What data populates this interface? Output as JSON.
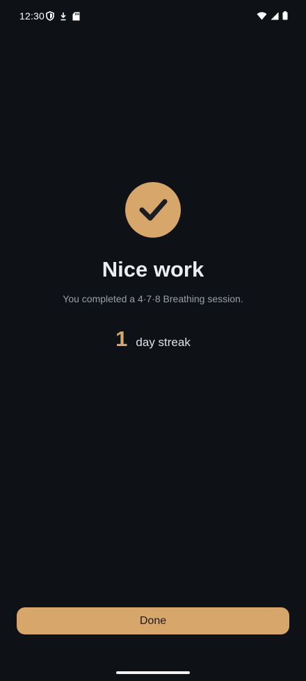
{
  "status_bar": {
    "time": "12:30",
    "left_icons": [
      "shield-icon",
      "download-icon",
      "sd-card-icon"
    ],
    "right_icons": [
      "wifi-icon",
      "cell-signal-icon",
      "battery-icon"
    ]
  },
  "completion": {
    "icon": "checkmark-icon",
    "headline": "Nice work",
    "message": "You completed a 4·7·8 Breathing session.",
    "streak_count": "1",
    "streak_label": "day streak"
  },
  "actions": {
    "done_label": "Done"
  },
  "colors": {
    "background": "#0e1116",
    "accent": "#d7a66a",
    "text_primary": "#eceef1",
    "text_secondary": "#9aa0a8"
  }
}
